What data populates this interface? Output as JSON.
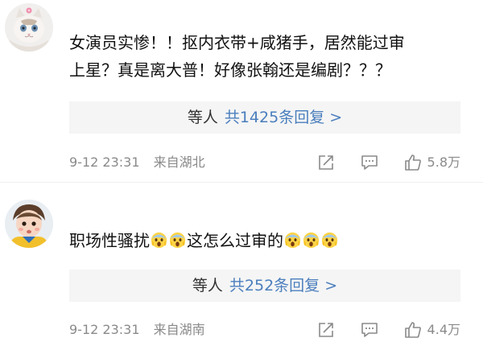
{
  "comments": [
    {
      "text_line1": "女演员实惨！！抠内衣带+咸猪手，居然能过审",
      "text_line2": "上星？真是离大普！好像张翰还是编剧？？？",
      "replies_who": "等人",
      "replies_count": "共1425条回复 >",
      "time": "9-12 23:31",
      "location": "来自湖北",
      "likes": "5.8万",
      "avatar": "cat-avatar"
    },
    {
      "text_main": "职场性骚扰",
      "text_mid": "这怎么过审的",
      "emoji": "scream-emoji",
      "replies_who": "等人",
      "replies_count": "共252条回复 >",
      "time": "9-12 23:31",
      "location": "来自湖南",
      "likes": "4.4万",
      "avatar": "baby-avatar"
    }
  ],
  "icons": {
    "share": "share-icon",
    "comment": "comment-icon",
    "like": "thumbs-up-icon"
  },
  "colors": {
    "link": "#4a7ebd",
    "meta": "#8a8a8a",
    "reply_bg": "#f5f5f5"
  }
}
